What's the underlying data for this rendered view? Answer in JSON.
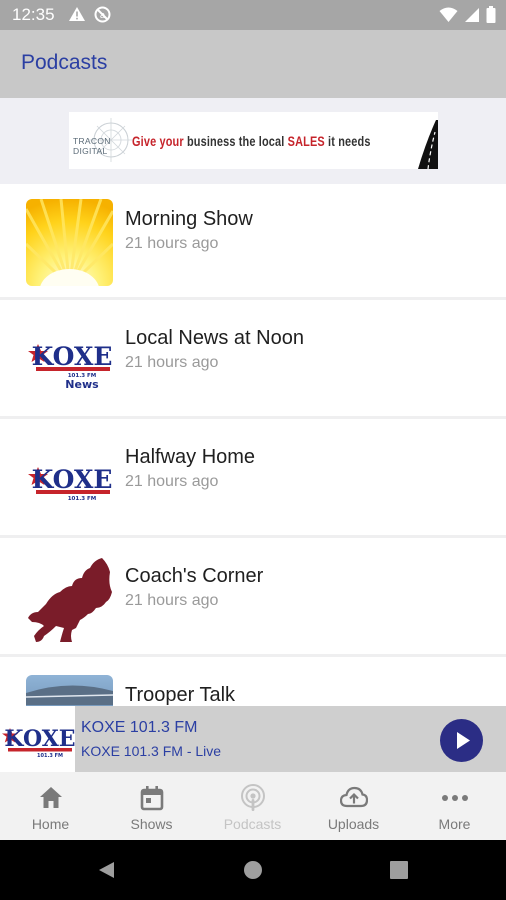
{
  "status_bar": {
    "time": "12:35"
  },
  "app_bar": {
    "title": "Podcasts"
  },
  "ad": {
    "logo_text": "TRACON DIGITAL",
    "word1": "Give your",
    "word2": "business the local",
    "word3": "SALES",
    "word4": "it needs"
  },
  "podcasts": [
    {
      "title": "Morning Show",
      "updated": "21 hours ago"
    },
    {
      "title": "Local News at Noon",
      "updated": "21 hours ago"
    },
    {
      "title": "Halfway Home",
      "updated": "21 hours ago"
    },
    {
      "title": "Coach's Corner",
      "updated": "21 hours ago"
    },
    {
      "title": "Trooper Talk",
      "updated": ""
    }
  ],
  "logo": {
    "name": "KOXE",
    "freq": "101.3 FM",
    "news": "News"
  },
  "player": {
    "title": "KOXE 101.3 FM",
    "subtitle": "KOXE 101.3 FM  - Live"
  },
  "tabs": [
    {
      "label": "Home",
      "icon": "home-icon"
    },
    {
      "label": "Shows",
      "icon": "calendar-icon"
    },
    {
      "label": "Podcasts",
      "icon": "podcast-icon",
      "active": true
    },
    {
      "label": "Uploads",
      "icon": "cloud-upload-icon"
    },
    {
      "label": "More",
      "icon": "more-dots-icon"
    }
  ],
  "colors": {
    "accent": "#2b3fa3",
    "play": "#2b2d85",
    "brand_red": "#c6242b"
  }
}
